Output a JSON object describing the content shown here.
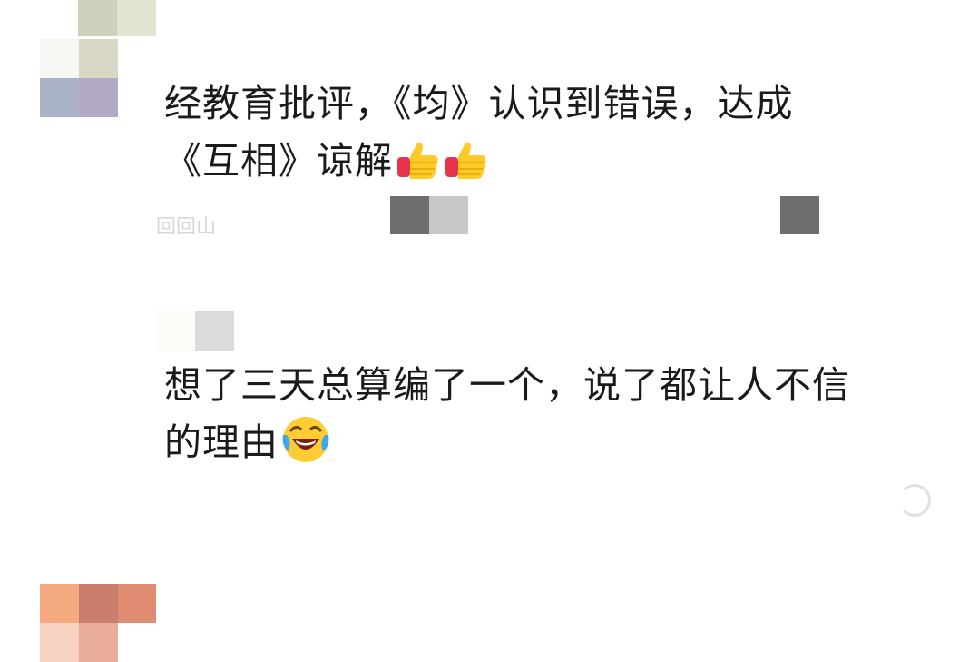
{
  "comments": [
    {
      "avatar": "pixelated-avatar",
      "text_line1": "经教育批评，《均》认识到错误，达成",
      "text_line2": "《互相》谅解",
      "emoji": [
        "thumbs-up-emoji",
        "thumbs-up-emoji"
      ],
      "meta_blurred": "回回山"
    },
    {
      "avatar": "pixelated-avatar",
      "text_line1": "想了三天总算编了一个，说了都让人不信",
      "text_line2": "的理由",
      "emoji": [
        "crying-laughing-face-emoji"
      ]
    }
  ],
  "icons": {
    "reply": "reply-icon"
  }
}
